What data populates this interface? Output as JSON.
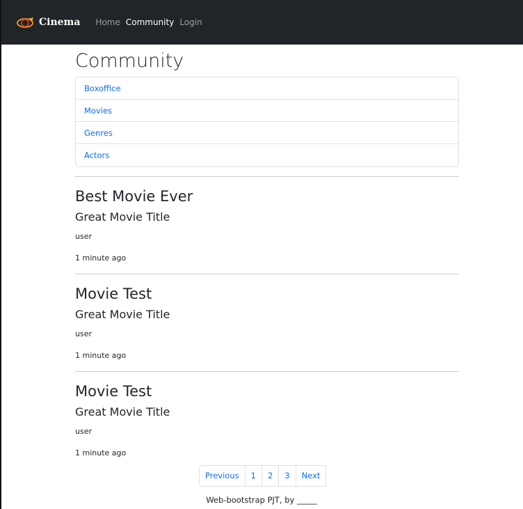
{
  "navbar": {
    "brand": "Cinema",
    "links": [
      {
        "label": "Home",
        "active": false
      },
      {
        "label": "Community",
        "active": true
      },
      {
        "label": "Login",
        "active": false
      }
    ],
    "background": "#212529"
  },
  "main": {
    "title": "Community",
    "menu": [
      "Boxoffice",
      "Movies",
      "Genres",
      "Actors"
    ],
    "posts": [
      {
        "title": "Best Movie Ever",
        "movie": "Great Movie Title",
        "user": "user",
        "time": "1 minute ago"
      },
      {
        "title": "Movie Test",
        "movie": "Great Movie Title",
        "user": "user",
        "time": "1 minute ago"
      },
      {
        "title": "Movie Test",
        "movie": "Great Movie Title",
        "user": "user",
        "time": "1 minute ago"
      }
    ]
  },
  "pagination": {
    "previous": "Previous",
    "pages": [
      "1",
      "2",
      "3"
    ],
    "next": "Next"
  },
  "footer": {
    "text": "Web-bootstrap PJT, by _____"
  },
  "colors": {
    "link": "#0d6efd",
    "brand_icon_orange": "#f0a020",
    "brand_icon_red": "#d63a2a"
  }
}
